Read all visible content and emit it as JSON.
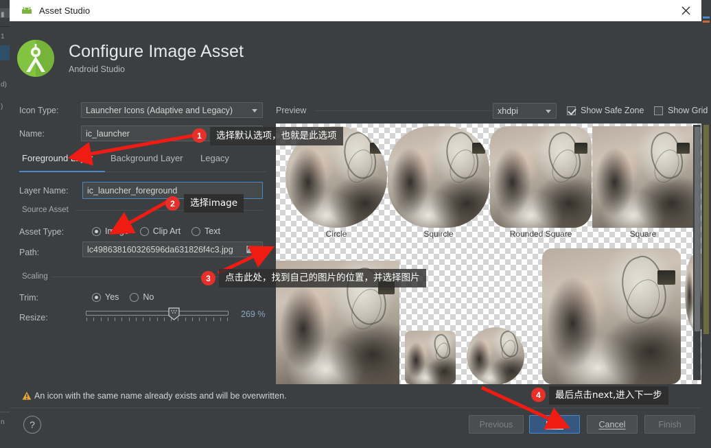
{
  "window": {
    "title": "Asset Studio",
    "close_icon": "close-icon",
    "app_icon": "android-icon"
  },
  "header": {
    "title": "Configure Image Asset",
    "subtitle": "Android Studio",
    "logo_icon": "android-studio-logo-icon"
  },
  "form": {
    "icon_type_label": "Icon Type:",
    "icon_type_value": "Launcher Icons (Adaptive and Legacy)",
    "name_label": "Name:",
    "name_value": "ic_launcher",
    "tabs": [
      {
        "label": "Foreground Layer",
        "active": true
      },
      {
        "label": "Background Layer",
        "active": false
      },
      {
        "label": "Legacy",
        "active": false
      }
    ],
    "layer_name_label": "Layer Name:",
    "layer_name_value": "ic_launcher_foreground",
    "source_asset_title": "Source Asset",
    "asset_type_label": "Asset Type:",
    "asset_type_options": [
      {
        "label": "Image",
        "selected": true
      },
      {
        "label": "Clip Art",
        "selected": false
      },
      {
        "label": "Text",
        "selected": false
      }
    ],
    "path_label": "Path:",
    "path_value": "lc498638160326596da631826f4c3.jpg",
    "path_browse_icon": "folder-browse-icon",
    "scaling_title": "Scaling",
    "trim_label": "Trim:",
    "trim_options": [
      {
        "label": "Yes",
        "selected": true
      },
      {
        "label": "No",
        "selected": false
      }
    ],
    "resize_label": "Resize:",
    "resize_value": "269 %",
    "resize_percent": 269
  },
  "preview": {
    "label": "Preview",
    "density_value": "xhdpi",
    "show_safe_zone": {
      "label": "Show Safe Zone",
      "checked": true
    },
    "show_grid": {
      "label": "Show Grid",
      "checked": false
    },
    "shapes": [
      {
        "label": "Circle"
      },
      {
        "label": "Squircle"
      },
      {
        "label": "Rounded Square"
      },
      {
        "label": "Square"
      }
    ]
  },
  "footer": {
    "warning_icon": "warning-icon",
    "warning_text": "An icon with the same name already exists and will be overwritten.",
    "help_label": "?",
    "previous_label": "Previous",
    "next_label": "Next",
    "cancel_label": "Cancel",
    "finish_label": "Finish"
  },
  "annotations": [
    {
      "num": "1",
      "text": "选择默认选项，也就是此选项"
    },
    {
      "num": "2",
      "text": "选择image"
    },
    {
      "num": "3",
      "text": "点击此处，找到自己的图片的位置，并选择图片"
    },
    {
      "num": "4",
      "text": "最后点击next,进入下一步"
    }
  ],
  "colors": {
    "accent": "#4a88c7",
    "annotation_red": "#e8302a",
    "panel_bg": "#3c3f41",
    "primary_button": "#365880",
    "warning": "#e8a43a"
  }
}
